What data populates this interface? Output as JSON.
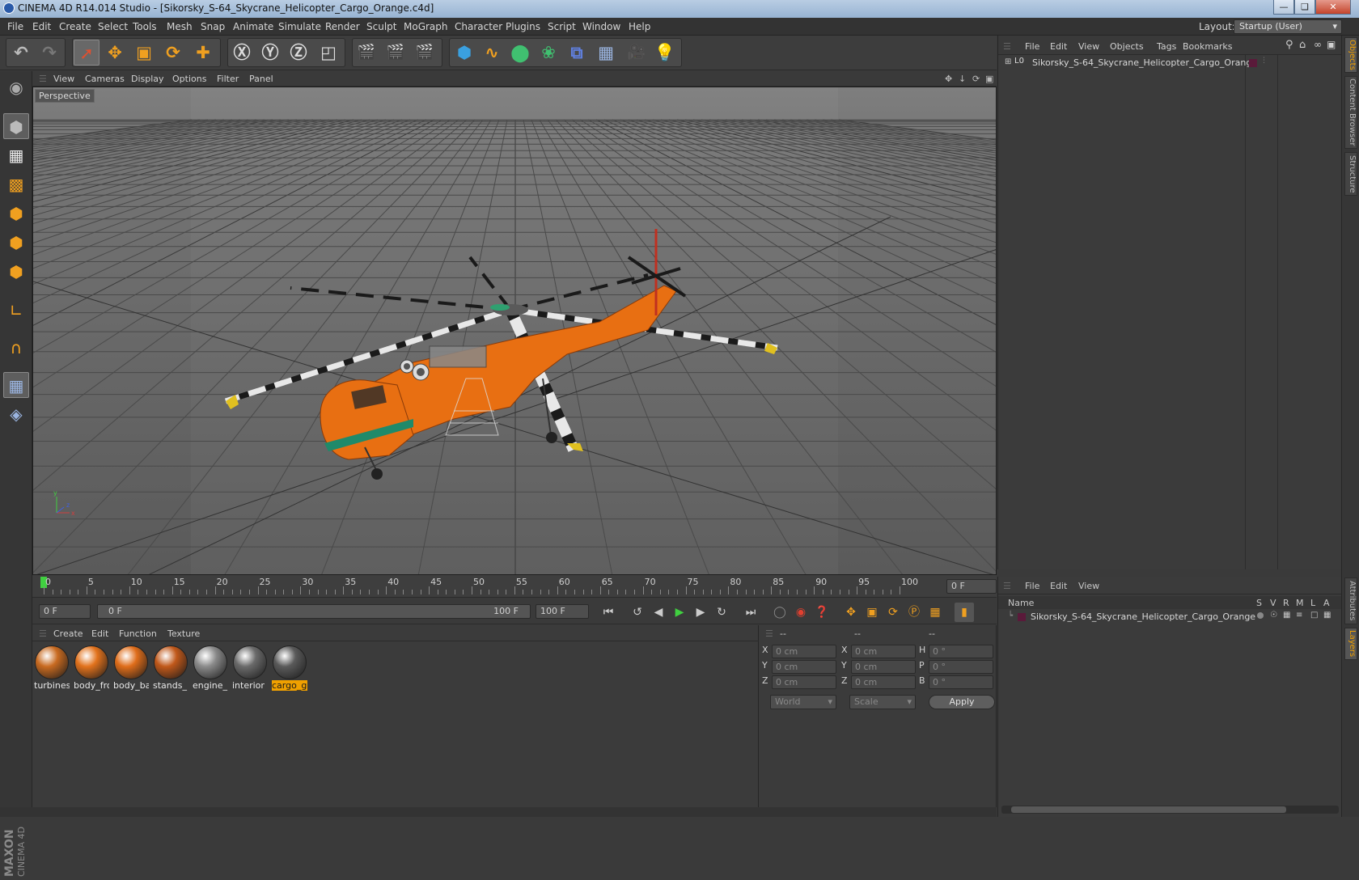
{
  "window": {
    "title": "CINEMA 4D R14.014 Studio - [Sikorsky_S-64_Skycrane_Helicopter_Cargo_Orange.c4d]"
  },
  "menu": [
    "File",
    "Edit",
    "Create",
    "Select",
    "Tools",
    "Mesh",
    "Snap",
    "Animate",
    "Simulate",
    "Render",
    "Sculpt",
    "MoGraph",
    "Character",
    "Plugins",
    "Script",
    "Window",
    "Help"
  ],
  "layout": {
    "label": "Layout:",
    "value": "Startup (User)"
  },
  "viewport": {
    "menu": [
      "View",
      "Cameras",
      "Display",
      "Options",
      "Filter",
      "Panel"
    ],
    "camera_label": "Perspective"
  },
  "timeline": {
    "ticks": [
      "0",
      "5",
      "10",
      "15",
      "20",
      "25",
      "30",
      "35",
      "40",
      "45",
      "50",
      "55",
      "60",
      "65",
      "70",
      "75",
      "80",
      "85",
      "90",
      "95",
      "100"
    ],
    "frame_field": "0 F"
  },
  "playback": {
    "start": "0 F",
    "slider_start": "0 F",
    "slider_end": "100 F",
    "end": "100 F"
  },
  "materials": {
    "menu": [
      "Create",
      "Edit",
      "Function",
      "Texture"
    ],
    "items": [
      {
        "name": "turbines",
        "color": "#c86a20"
      },
      {
        "name": "body_fro",
        "color": "#e2721c"
      },
      {
        "name": "body_ba",
        "color": "#df6d1a"
      },
      {
        "name": "stands_",
        "color": "#c0581a"
      },
      {
        "name": "engine_",
        "color": "#8a8a8a"
      },
      {
        "name": "interior",
        "color": "#6a6a6a"
      },
      {
        "name": "cargo_g",
        "color": "#5a5a5a"
      }
    ]
  },
  "coords": {
    "headers": [
      "--",
      "--",
      "--"
    ],
    "rows": [
      {
        "a": "X",
        "v1": "0 cm",
        "b": "X",
        "v2": "0 cm",
        "c": "H",
        "v3": "0 °"
      },
      {
        "a": "Y",
        "v1": "0 cm",
        "b": "Y",
        "v2": "0 cm",
        "c": "P",
        "v3": "0 °"
      },
      {
        "a": "Z",
        "v1": "0 cm",
        "b": "Z",
        "v2": "0 cm",
        "c": "B",
        "v3": "0 °"
      }
    ],
    "mode": "World",
    "scale": "Scale",
    "apply": "Apply"
  },
  "objects": {
    "menu": [
      "File",
      "Edit",
      "View",
      "Objects",
      "Tags",
      "Bookmarks"
    ],
    "items": [
      {
        "name": "Sikorsky_S-64_Skycrane_Helicopter_Cargo_Orange",
        "color": "#5a1a3a"
      }
    ]
  },
  "layers": {
    "menu": [
      "File",
      "Edit",
      "View"
    ],
    "header": {
      "name": "Name",
      "cols": [
        "S",
        "V",
        "R",
        "M",
        "L",
        "A"
      ]
    },
    "items": [
      {
        "name": "Sikorsky_S-64_Skycrane_Helicopter_Cargo_Orange",
        "color": "#5a1a3a"
      }
    ]
  },
  "side_tabs": [
    "Objects",
    "Content Browser",
    "Structure",
    "Attributes",
    "Layers"
  ],
  "branding": {
    "maxon": "MAXON",
    "product": "CINEMA 4D"
  },
  "colors": {
    "accent": "#f0a000",
    "helicopter": "#e86f12"
  }
}
